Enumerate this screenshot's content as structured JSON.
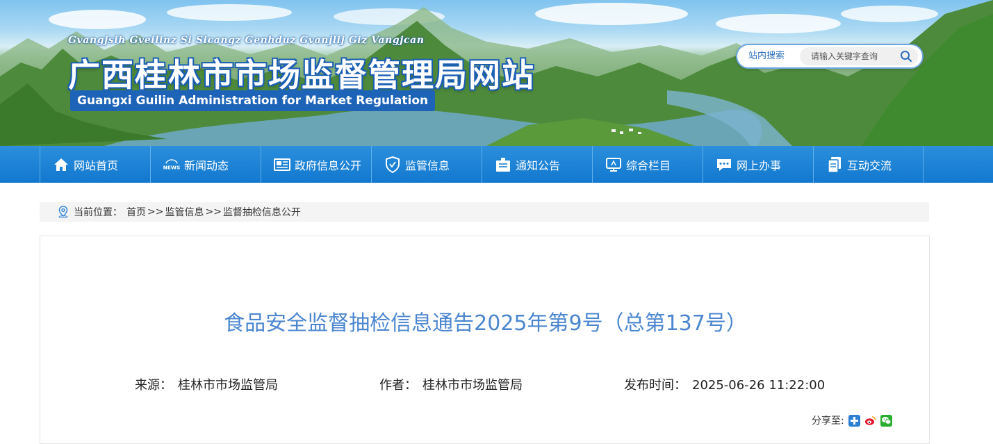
{
  "header": {
    "roman_name": "Gvangjsih Gveilinz Si Sicangz Genhduz Gvanjlij Giz Vangjcan",
    "title": "广西桂林市市场监督管理局网站",
    "english_name": "Guangxi Guilin Administration for Market Regulation",
    "search": {
      "label": "站内搜索",
      "placeholder": "请输入关键字查询",
      "button_icon": "search-icon"
    }
  },
  "nav": {
    "items": [
      {
        "label": "网站首页",
        "icon": "home-icon"
      },
      {
        "label": "新闻动态",
        "icon": "news-icon"
      },
      {
        "label": "政府信息公开",
        "icon": "newspaper-icon"
      },
      {
        "label": "监管信息",
        "icon": "shield-icon"
      },
      {
        "label": "通知公告",
        "icon": "notice-icon"
      },
      {
        "label": "综合栏目",
        "icon": "monitor-icon"
      },
      {
        "label": "网上办事",
        "icon": "chat-icon"
      },
      {
        "label": "互动交流",
        "icon": "documents-icon"
      }
    ]
  },
  "breadcrumb": {
    "prefix": "当前位置：",
    "items": [
      "首页",
      "监管信息",
      "监督抽检信息公开"
    ],
    "separator": ">>"
  },
  "article": {
    "title": "食品安全监督抽检信息通告2025年第9号（总第137号）",
    "source_label": "来源：",
    "source_value": "桂林市市场监管局",
    "author_label": "作者：",
    "author_value": "桂林市市场监管局",
    "time_label": "发布时间：",
    "time_value": "2025-06-26 11:22:00",
    "share_label": "分享至:",
    "share_icons": [
      "qzone-icon",
      "weibo-icon",
      "wechat-icon"
    ]
  },
  "colors": {
    "nav_blue": "#1278cf",
    "title_blue": "#4b86cf",
    "banner_label_blue": "#1d63b8"
  }
}
